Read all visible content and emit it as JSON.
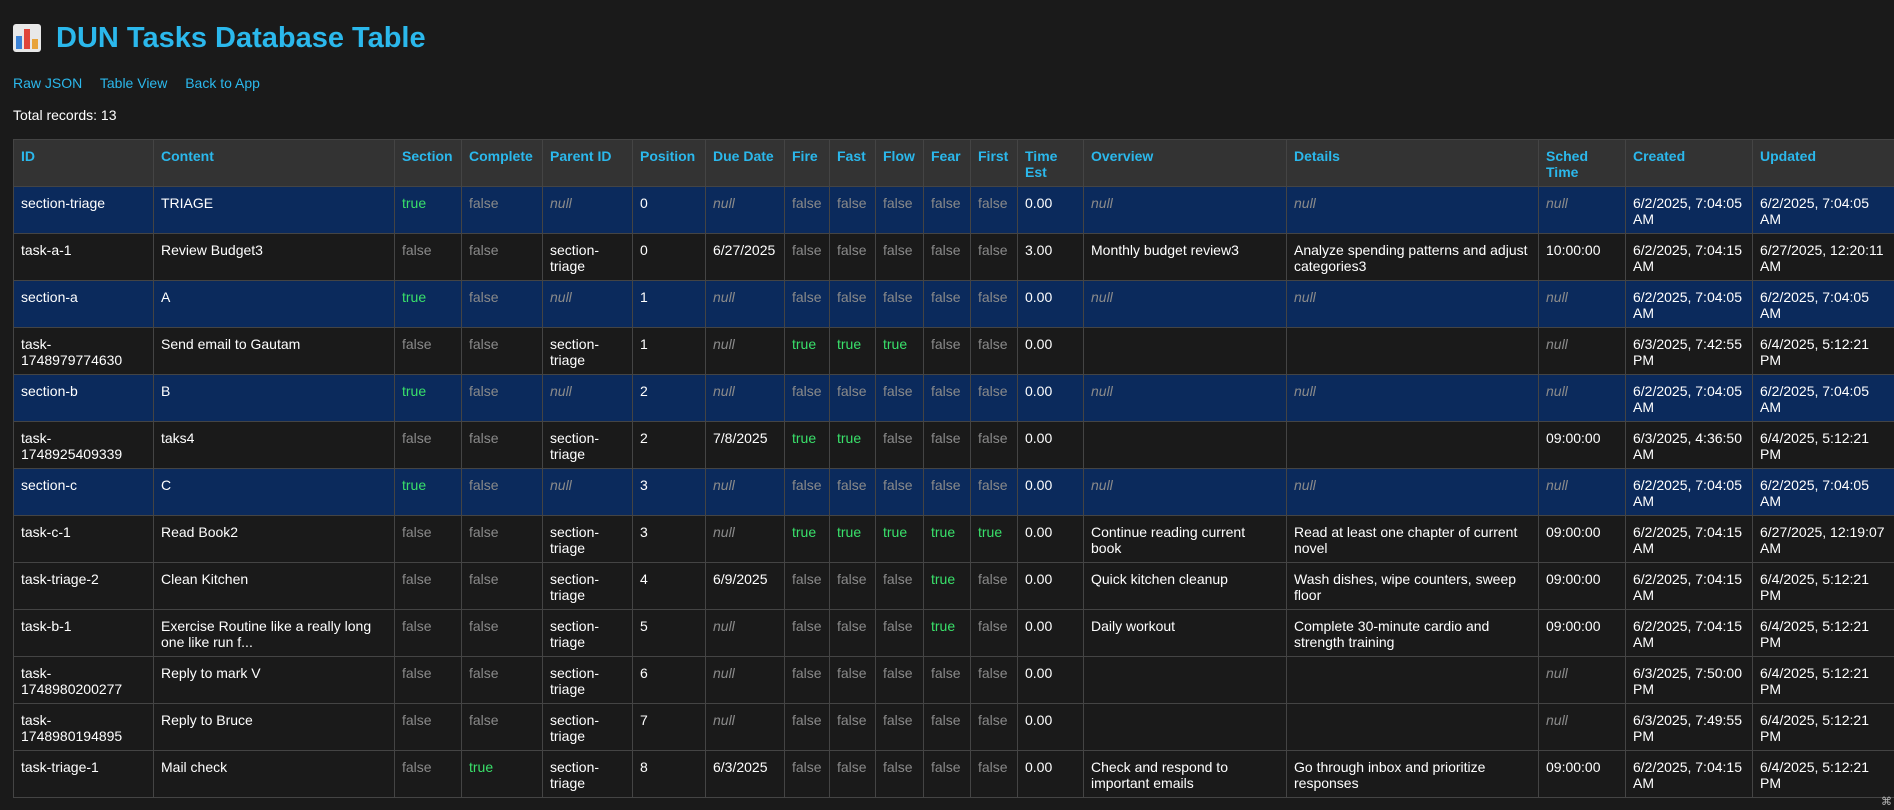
{
  "title": "DUN Tasks Database Table",
  "nav": {
    "raw_json": "Raw JSON",
    "table_view": "Table View",
    "back": "Back to App"
  },
  "total": "Total records: 13",
  "columns": [
    "ID",
    "Content",
    "Section",
    "Complete",
    "Parent ID",
    "Position",
    "Due Date",
    "Fire",
    "Fast",
    "Flow",
    "Fear",
    "First",
    "Time Est",
    "Overview",
    "Details",
    "Sched Time",
    "Created",
    "Updated"
  ],
  "rows": [
    [
      "section-triage",
      "TRIAGE",
      "true",
      "false",
      "null",
      "0",
      "null",
      "false",
      "false",
      "false",
      "false",
      "false",
      "0.00",
      "null",
      "null",
      "null",
      "6/2/2025, 7:04:05 AM",
      "6/2/2025, 7:04:05 AM"
    ],
    [
      "task-a-1",
      "Review Budget3",
      "false",
      "false",
      "section-triage",
      "0",
      "6/27/2025",
      "false",
      "false",
      "false",
      "false",
      "false",
      "3.00",
      "Monthly budget review3",
      "Analyze spending patterns and adjust categories3",
      "10:00:00",
      "6/2/2025, 7:04:15 AM",
      "6/27/2025, 12:20:11 AM"
    ],
    [
      "section-a",
      "A",
      "true",
      "false",
      "null",
      "1",
      "null",
      "false",
      "false",
      "false",
      "false",
      "false",
      "0.00",
      "null",
      "null",
      "null",
      "6/2/2025, 7:04:05 AM",
      "6/2/2025, 7:04:05 AM"
    ],
    [
      "task-1748979774630",
      "Send email to Gautam",
      "false",
      "false",
      "section-triage",
      "1",
      "null",
      "true",
      "true",
      "true",
      "false",
      "false",
      "0.00",
      "",
      "",
      "null",
      "6/3/2025, 7:42:55 PM",
      "6/4/2025, 5:12:21 PM"
    ],
    [
      "section-b",
      "B",
      "true",
      "false",
      "null",
      "2",
      "null",
      "false",
      "false",
      "false",
      "false",
      "false",
      "0.00",
      "null",
      "null",
      "null",
      "6/2/2025, 7:04:05 AM",
      "6/2/2025, 7:04:05 AM"
    ],
    [
      "task-1748925409339",
      "taks4",
      "false",
      "false",
      "section-triage",
      "2",
      "7/8/2025",
      "true",
      "true",
      "false",
      "false",
      "false",
      "0.00",
      "",
      "",
      "09:00:00",
      "6/3/2025, 4:36:50 AM",
      "6/4/2025, 5:12:21 PM"
    ],
    [
      "section-c",
      "C",
      "true",
      "false",
      "null",
      "3",
      "null",
      "false",
      "false",
      "false",
      "false",
      "false",
      "0.00",
      "null",
      "null",
      "null",
      "6/2/2025, 7:04:05 AM",
      "6/2/2025, 7:04:05 AM"
    ],
    [
      "task-c-1",
      "Read Book2",
      "false",
      "false",
      "section-triage",
      "3",
      "null",
      "true",
      "true",
      "true",
      "true",
      "true",
      "0.00",
      "Continue reading current book",
      "Read at least one chapter of current novel",
      "09:00:00",
      "6/2/2025, 7:04:15 AM",
      "6/27/2025, 12:19:07 AM"
    ],
    [
      "task-triage-2",
      "Clean Kitchen",
      "false",
      "false",
      "section-triage",
      "4",
      "6/9/2025",
      "false",
      "false",
      "false",
      "true",
      "false",
      "0.00",
      "Quick kitchen cleanup",
      "Wash dishes, wipe counters, sweep floor",
      "09:00:00",
      "6/2/2025, 7:04:15 AM",
      "6/4/2025, 5:12:21 PM"
    ],
    [
      "task-b-1",
      "Exercise Routine like a really long one like run f...",
      "false",
      "false",
      "section-triage",
      "5",
      "null",
      "false",
      "false",
      "false",
      "true",
      "false",
      "0.00",
      "Daily workout",
      "Complete 30-minute cardio and strength training",
      "09:00:00",
      "6/2/2025, 7:04:15 AM",
      "6/4/2025, 5:12:21 PM"
    ],
    [
      "task-1748980200277",
      "Reply to mark V",
      "false",
      "false",
      "section-triage",
      "6",
      "null",
      "false",
      "false",
      "false",
      "false",
      "false",
      "0.00",
      "",
      "",
      "null",
      "6/3/2025, 7:50:00 PM",
      "6/4/2025, 5:12:21 PM"
    ],
    [
      "task-1748980194895",
      "Reply to Bruce",
      "false",
      "false",
      "section-triage",
      "7",
      "null",
      "false",
      "false",
      "false",
      "false",
      "false",
      "0.00",
      "",
      "",
      "null",
      "6/3/2025, 7:49:55 PM",
      "6/4/2025, 5:12:21 PM"
    ],
    [
      "task-triage-1",
      "Mail check",
      "false",
      "true",
      "section-triage",
      "8",
      "6/3/2025",
      "false",
      "false",
      "false",
      "false",
      "false",
      "0.00",
      "Check and respond to important emails",
      "Go through inbox and prioritize responses",
      "09:00:00",
      "6/2/2025, 7:04:15 AM",
      "6/4/2025, 5:12:21 PM"
    ]
  ],
  "corner_glyph": "⌘"
}
